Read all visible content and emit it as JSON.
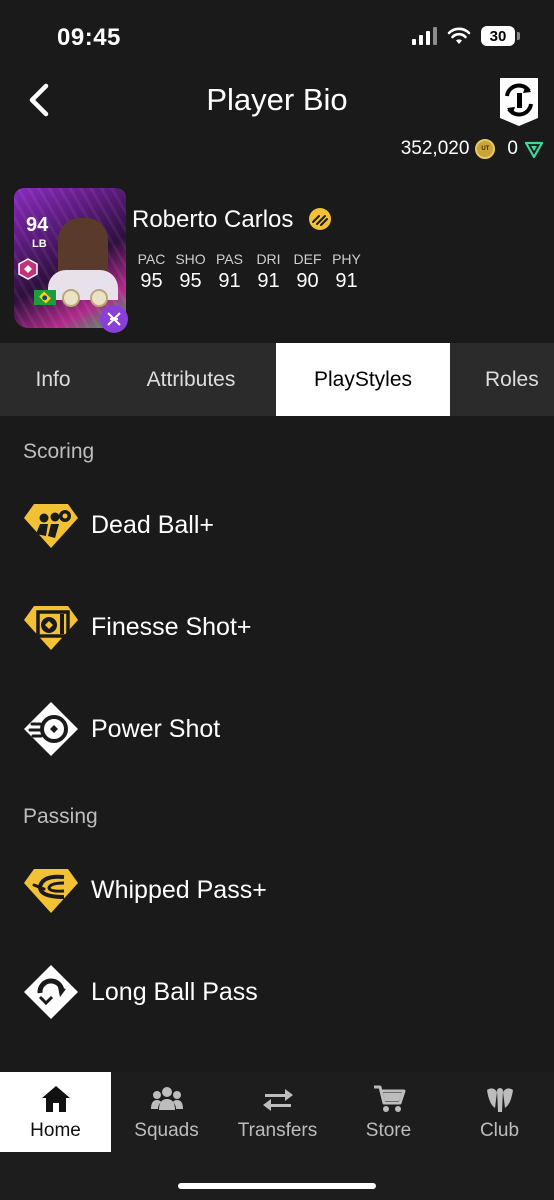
{
  "status_bar": {
    "time": "09:45",
    "battery": "30"
  },
  "header": {
    "title": "Player Bio"
  },
  "currency": {
    "coins": "352,020",
    "coin_label": "UT",
    "points": "0"
  },
  "player": {
    "name": "Roberto Carlos",
    "rating": "94",
    "position": "LB",
    "stats": [
      {
        "label": "PAC",
        "value": "95"
      },
      {
        "label": "SHO",
        "value": "95"
      },
      {
        "label": "PAS",
        "value": "91"
      },
      {
        "label": "DRI",
        "value": "91"
      },
      {
        "label": "DEF",
        "value": "90"
      },
      {
        "label": "PHY",
        "value": "91"
      }
    ]
  },
  "tabs": [
    {
      "label": "Info"
    },
    {
      "label": "Attributes"
    },
    {
      "label": "PlayStyles",
      "active": true
    },
    {
      "label": "Roles"
    }
  ],
  "sections": [
    {
      "title": "Scoring",
      "items": [
        {
          "label": "Dead Ball+",
          "icon": "dead-ball-plus-icon",
          "tier": "gold"
        },
        {
          "label": "Finesse Shot+",
          "icon": "finesse-shot-plus-icon",
          "tier": "gold"
        },
        {
          "label": "Power Shot",
          "icon": "power-shot-icon",
          "tier": "white"
        }
      ]
    },
    {
      "title": "Passing",
      "items": [
        {
          "label": "Whipped Pass+",
          "icon": "whipped-pass-plus-icon",
          "tier": "gold"
        },
        {
          "label": "Long Ball Pass",
          "icon": "long-ball-pass-icon",
          "tier": "white"
        }
      ]
    }
  ],
  "bottom_nav": [
    {
      "label": "Home",
      "icon": "home-icon",
      "active": true
    },
    {
      "label": "Squads",
      "icon": "squads-icon"
    },
    {
      "label": "Transfers",
      "icon": "transfers-icon"
    },
    {
      "label": "Store",
      "icon": "store-icon"
    },
    {
      "label": "Club",
      "icon": "club-icon"
    }
  ],
  "colors": {
    "background": "#1a1a1a",
    "gold": "#f3c234",
    "tab_bar": "#2b2b2b",
    "evo_purple": "#8a3fd8"
  }
}
